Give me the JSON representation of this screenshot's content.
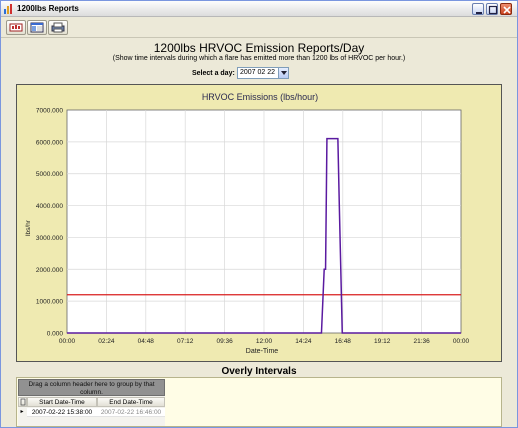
{
  "window": {
    "title": "1200lbs Reports"
  },
  "toolbar": {
    "buttons": [
      "export-button",
      "view-button",
      "print-button"
    ]
  },
  "report": {
    "title": "1200lbs HRVOC Emission Reports/Day",
    "subtitle": "(Show time intervals during which a flare has emitted more than 1200 lbs of HRVOC per hour.)",
    "day_label": "Select a day:",
    "day_value": "2007 02 22"
  },
  "chart_data": {
    "type": "line",
    "title": "HRVOC Emissions (lbs/hour)",
    "xlabel": "Date-Time",
    "ylabel": "lbs/hr",
    "ylim": [
      0,
      7000
    ],
    "yticks": [
      "0.000",
      "1000.000",
      "2000.000",
      "3000.000",
      "4000.000",
      "5000.000",
      "6000.000",
      "7000.000"
    ],
    "xticks": [
      "00:00",
      "02:24",
      "04:48",
      "07:12",
      "09:36",
      "12:00",
      "14:24",
      "16:48",
      "19:12",
      "21:36",
      "00:00"
    ],
    "grid": true,
    "series": [
      {
        "color": "#5a1aa0",
        "x": [
          "00:00",
          "15:30",
          "15:40",
          "15:45",
          "15:50",
          "16:30",
          "16:35",
          "16:46",
          "24:00"
        ],
        "y": [
          0,
          0,
          2000,
          2000,
          6100,
          6100,
          4100,
          0,
          0
        ]
      }
    ],
    "threshold": {
      "value": 1200,
      "color": "#d91f1f"
    }
  },
  "grid": {
    "title": "Overly Intervals",
    "group_hint": "Drag a column header here to group by that column.",
    "columns": [
      "Start Date-Time",
      "End Date-Time"
    ],
    "rows": [
      {
        "start": "2007-02-22 15:38:00",
        "end": "2007-02-22 16:46:00"
      }
    ]
  }
}
